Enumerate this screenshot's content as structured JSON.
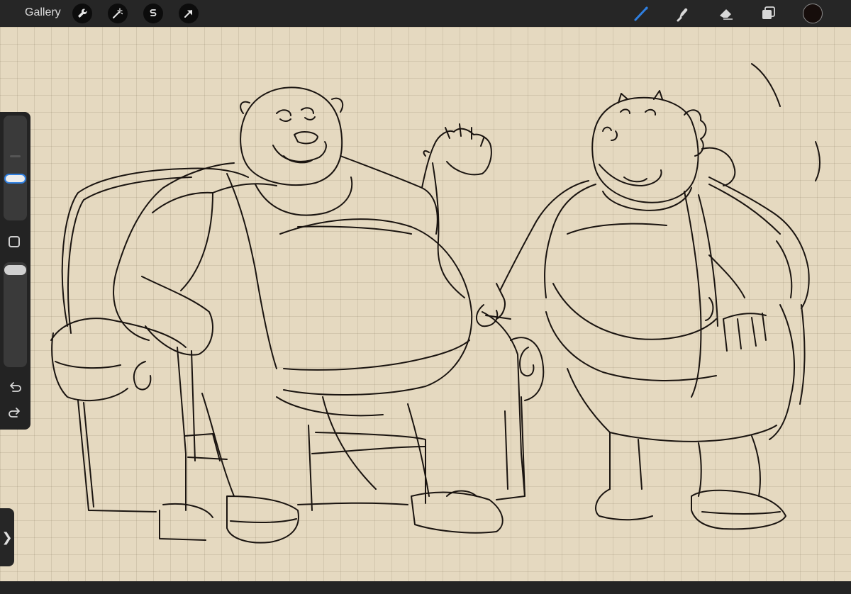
{
  "toolbar": {
    "gallery_label": "Gallery",
    "left_tools": [
      "wrench-icon",
      "magic-wand-icon",
      "selection-icon",
      "transform-arrow-icon"
    ],
    "right_tools": [
      "brush-icon",
      "smudge-icon",
      "eraser-icon",
      "layers-icon"
    ],
    "active_tool": "brush-icon",
    "active_color": "#160d0b",
    "accent_color": "#2f7fe0"
  },
  "sidebar": {
    "brush_size_level": 0.38,
    "opacity_level": 1.0,
    "buttons": [
      "modify-square",
      "undo",
      "redo"
    ]
  },
  "expand_tab_glyph": "❯",
  "canvas": {
    "paper_color": "#e5d9c0",
    "ink_color": "#1a1410",
    "grid": true
  }
}
